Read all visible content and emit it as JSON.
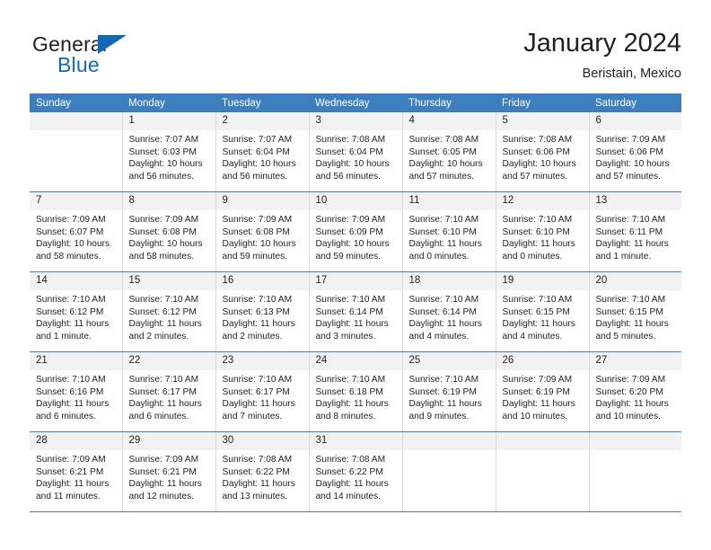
{
  "brand": {
    "name_top": "General",
    "name_bottom": "Blue",
    "triangle_icon": "triangle-icon",
    "color_dark": "#231f20",
    "color_blue": "#1268b3"
  },
  "header": {
    "title": "January 2024",
    "subtitle": "Beristain, Mexico"
  },
  "theme": {
    "header_row_bg": "#3d7ebd",
    "header_row_text": "#ffffff",
    "daynum_bg": "#f2f2f2",
    "cell_border": "#d9d9d9",
    "week_divider": "#3d7ebd"
  },
  "weekdays": [
    "Sunday",
    "Monday",
    "Tuesday",
    "Wednesday",
    "Thursday",
    "Friday",
    "Saturday"
  ],
  "weeks": [
    [
      {
        "day": "",
        "sunrise": "",
        "sunset": "",
        "daylight_line1": "",
        "daylight_line2": ""
      },
      {
        "day": "1",
        "sunrise": "Sunrise: 7:07 AM",
        "sunset": "Sunset: 6:03 PM",
        "daylight_line1": "Daylight: 10 hours",
        "daylight_line2": "and 56 minutes."
      },
      {
        "day": "2",
        "sunrise": "Sunrise: 7:07 AM",
        "sunset": "Sunset: 6:04 PM",
        "daylight_line1": "Daylight: 10 hours",
        "daylight_line2": "and 56 minutes."
      },
      {
        "day": "3",
        "sunrise": "Sunrise: 7:08 AM",
        "sunset": "Sunset: 6:04 PM",
        "daylight_line1": "Daylight: 10 hours",
        "daylight_line2": "and 56 minutes."
      },
      {
        "day": "4",
        "sunrise": "Sunrise: 7:08 AM",
        "sunset": "Sunset: 6:05 PM",
        "daylight_line1": "Daylight: 10 hours",
        "daylight_line2": "and 57 minutes."
      },
      {
        "day": "5",
        "sunrise": "Sunrise: 7:08 AM",
        "sunset": "Sunset: 6:06 PM",
        "daylight_line1": "Daylight: 10 hours",
        "daylight_line2": "and 57 minutes."
      },
      {
        "day": "6",
        "sunrise": "Sunrise: 7:09 AM",
        "sunset": "Sunset: 6:06 PM",
        "daylight_line1": "Daylight: 10 hours",
        "daylight_line2": "and 57 minutes."
      }
    ],
    [
      {
        "day": "7",
        "sunrise": "Sunrise: 7:09 AM",
        "sunset": "Sunset: 6:07 PM",
        "daylight_line1": "Daylight: 10 hours",
        "daylight_line2": "and 58 minutes."
      },
      {
        "day": "8",
        "sunrise": "Sunrise: 7:09 AM",
        "sunset": "Sunset: 6:08 PM",
        "daylight_line1": "Daylight: 10 hours",
        "daylight_line2": "and 58 minutes."
      },
      {
        "day": "9",
        "sunrise": "Sunrise: 7:09 AM",
        "sunset": "Sunset: 6:08 PM",
        "daylight_line1": "Daylight: 10 hours",
        "daylight_line2": "and 59 minutes."
      },
      {
        "day": "10",
        "sunrise": "Sunrise: 7:09 AM",
        "sunset": "Sunset: 6:09 PM",
        "daylight_line1": "Daylight: 10 hours",
        "daylight_line2": "and 59 minutes."
      },
      {
        "day": "11",
        "sunrise": "Sunrise: 7:10 AM",
        "sunset": "Sunset: 6:10 PM",
        "daylight_line1": "Daylight: 11 hours",
        "daylight_line2": "and 0 minutes."
      },
      {
        "day": "12",
        "sunrise": "Sunrise: 7:10 AM",
        "sunset": "Sunset: 6:10 PM",
        "daylight_line1": "Daylight: 11 hours",
        "daylight_line2": "and 0 minutes."
      },
      {
        "day": "13",
        "sunrise": "Sunrise: 7:10 AM",
        "sunset": "Sunset: 6:11 PM",
        "daylight_line1": "Daylight: 11 hours",
        "daylight_line2": "and 1 minute."
      }
    ],
    [
      {
        "day": "14",
        "sunrise": "Sunrise: 7:10 AM",
        "sunset": "Sunset: 6:12 PM",
        "daylight_line1": "Daylight: 11 hours",
        "daylight_line2": "and 1 minute."
      },
      {
        "day": "15",
        "sunrise": "Sunrise: 7:10 AM",
        "sunset": "Sunset: 6:12 PM",
        "daylight_line1": "Daylight: 11 hours",
        "daylight_line2": "and 2 minutes."
      },
      {
        "day": "16",
        "sunrise": "Sunrise: 7:10 AM",
        "sunset": "Sunset: 6:13 PM",
        "daylight_line1": "Daylight: 11 hours",
        "daylight_line2": "and 2 minutes."
      },
      {
        "day": "17",
        "sunrise": "Sunrise: 7:10 AM",
        "sunset": "Sunset: 6:14 PM",
        "daylight_line1": "Daylight: 11 hours",
        "daylight_line2": "and 3 minutes."
      },
      {
        "day": "18",
        "sunrise": "Sunrise: 7:10 AM",
        "sunset": "Sunset: 6:14 PM",
        "daylight_line1": "Daylight: 11 hours",
        "daylight_line2": "and 4 minutes."
      },
      {
        "day": "19",
        "sunrise": "Sunrise: 7:10 AM",
        "sunset": "Sunset: 6:15 PM",
        "daylight_line1": "Daylight: 11 hours",
        "daylight_line2": "and 4 minutes."
      },
      {
        "day": "20",
        "sunrise": "Sunrise: 7:10 AM",
        "sunset": "Sunset: 6:15 PM",
        "daylight_line1": "Daylight: 11 hours",
        "daylight_line2": "and 5 minutes."
      }
    ],
    [
      {
        "day": "21",
        "sunrise": "Sunrise: 7:10 AM",
        "sunset": "Sunset: 6:16 PM",
        "daylight_line1": "Daylight: 11 hours",
        "daylight_line2": "and 6 minutes."
      },
      {
        "day": "22",
        "sunrise": "Sunrise: 7:10 AM",
        "sunset": "Sunset: 6:17 PM",
        "daylight_line1": "Daylight: 11 hours",
        "daylight_line2": "and 6 minutes."
      },
      {
        "day": "23",
        "sunrise": "Sunrise: 7:10 AM",
        "sunset": "Sunset: 6:17 PM",
        "daylight_line1": "Daylight: 11 hours",
        "daylight_line2": "and 7 minutes."
      },
      {
        "day": "24",
        "sunrise": "Sunrise: 7:10 AM",
        "sunset": "Sunset: 6:18 PM",
        "daylight_line1": "Daylight: 11 hours",
        "daylight_line2": "and 8 minutes."
      },
      {
        "day": "25",
        "sunrise": "Sunrise: 7:10 AM",
        "sunset": "Sunset: 6:19 PM",
        "daylight_line1": "Daylight: 11 hours",
        "daylight_line2": "and 9 minutes."
      },
      {
        "day": "26",
        "sunrise": "Sunrise: 7:09 AM",
        "sunset": "Sunset: 6:19 PM",
        "daylight_line1": "Daylight: 11 hours",
        "daylight_line2": "and 10 minutes."
      },
      {
        "day": "27",
        "sunrise": "Sunrise: 7:09 AM",
        "sunset": "Sunset: 6:20 PM",
        "daylight_line1": "Daylight: 11 hours",
        "daylight_line2": "and 10 minutes."
      }
    ],
    [
      {
        "day": "28",
        "sunrise": "Sunrise: 7:09 AM",
        "sunset": "Sunset: 6:21 PM",
        "daylight_line1": "Daylight: 11 hours",
        "daylight_line2": "and 11 minutes."
      },
      {
        "day": "29",
        "sunrise": "Sunrise: 7:09 AM",
        "sunset": "Sunset: 6:21 PM",
        "daylight_line1": "Daylight: 11 hours",
        "daylight_line2": "and 12 minutes."
      },
      {
        "day": "30",
        "sunrise": "Sunrise: 7:08 AM",
        "sunset": "Sunset: 6:22 PM",
        "daylight_line1": "Daylight: 11 hours",
        "daylight_line2": "and 13 minutes."
      },
      {
        "day": "31",
        "sunrise": "Sunrise: 7:08 AM",
        "sunset": "Sunset: 6:22 PM",
        "daylight_line1": "Daylight: 11 hours",
        "daylight_line2": "and 14 minutes."
      },
      {
        "day": "",
        "sunrise": "",
        "sunset": "",
        "daylight_line1": "",
        "daylight_line2": ""
      },
      {
        "day": "",
        "sunrise": "",
        "sunset": "",
        "daylight_line1": "",
        "daylight_line2": ""
      },
      {
        "day": "",
        "sunrise": "",
        "sunset": "",
        "daylight_line1": "",
        "daylight_line2": ""
      }
    ]
  ]
}
